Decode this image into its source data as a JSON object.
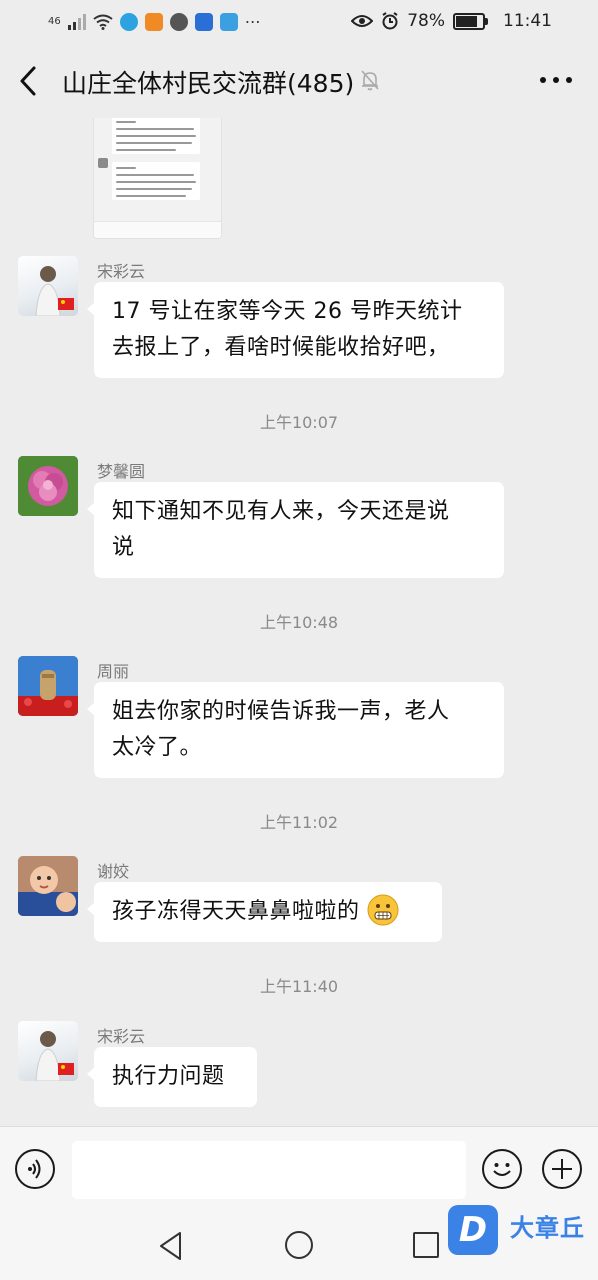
{
  "status_bar": {
    "network": "46",
    "battery": "78%",
    "time": "11:41"
  },
  "header": {
    "title": "山庄全体村民交流群(485)",
    "back_icon": "chevron-left-icon",
    "mute_icon": "bell-off-icon",
    "more_icon": "more-dots-icon"
  },
  "messages": [
    {
      "sender": "宋彩云",
      "lines": [
        "17 号让在家等今天 26 号昨天统计",
        "去报上了，看啥时候能收拾好吧，"
      ]
    },
    {
      "time": "上午10:07"
    },
    {
      "sender": "梦馨圆",
      "lines": [
        "知下通知不见有人来，今天还是说",
        "说"
      ]
    },
    {
      "time": "上午10:48"
    },
    {
      "sender": "周丽",
      "lines": [
        "姐去你家的时候告诉我一声，老人",
        "太冷了。"
      ]
    },
    {
      "time": "上午11:02"
    },
    {
      "sender": "谢姣",
      "lines": [
        "孩子冻得天天鼻鼻啦啦的"
      ],
      "emoji": "grimace-emoji-icon"
    },
    {
      "time": "上午11:40"
    },
    {
      "sender": "宋彩云",
      "lines": [
        "执行力问题"
      ]
    }
  ],
  "input_bar": {
    "text": ""
  },
  "watermark": {
    "logo": "D",
    "text": "大章丘"
  },
  "colors": {
    "background": "#ededed",
    "bubble": "#ffffff",
    "watermark": "#3b82e6"
  }
}
